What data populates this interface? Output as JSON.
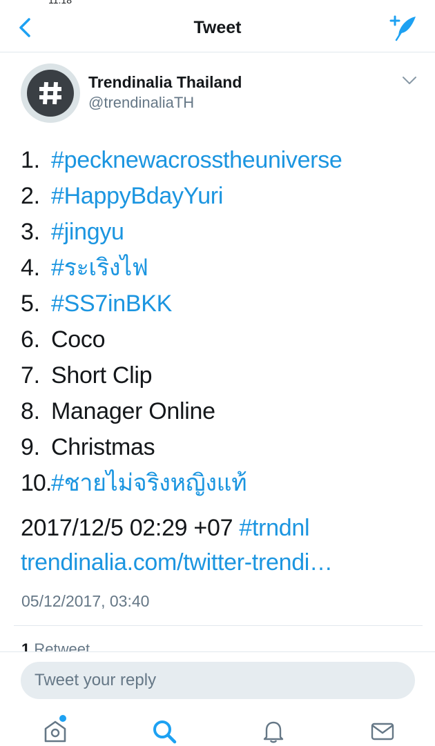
{
  "nav": {
    "title": "Tweet",
    "back_icon": "chevron-left-icon",
    "compose_icon": "compose-tweet-icon",
    "accent": "#1da1f2"
  },
  "status_fragment": "11:18",
  "tweet": {
    "author": {
      "name": "Trendinalia Thailand",
      "handle": "@trendinaliaTH",
      "avatar_icon": "hashtag-avatar-icon"
    },
    "trends": [
      {
        "num": "1.",
        "label": "#pecknewacrosstheuniverse",
        "is_link": true
      },
      {
        "num": "2.",
        "label": "#HappyBdayYuri",
        "is_link": true
      },
      {
        "num": "3.",
        "label": "#jingyu",
        "is_link": true
      },
      {
        "num": "4.",
        "label": "#ระเริงไฟ",
        "is_link": true
      },
      {
        "num": "5.",
        "label": "#SS7inBKK",
        "is_link": true
      },
      {
        "num": "6.",
        "label": "Coco",
        "is_link": false
      },
      {
        "num": "7.",
        "label": "Short Clip",
        "is_link": false
      },
      {
        "num": "8.",
        "label": "Manager Online",
        "is_link": false
      },
      {
        "num": "9.",
        "label": "Christmas",
        "is_link": false
      },
      {
        "num": "10.",
        "label": "#ชายไม่จริงหญิงแท้",
        "is_link": true
      }
    ],
    "datetime_text": "2017/12/5 02:29 +07",
    "hashtag": "#trndnl",
    "url_text": "trendinalia.com/twitter-trendi…",
    "timestamp": "05/12/2017, 03:40",
    "retweet_count": "1",
    "retweet_label": "Retweet"
  },
  "reply": {
    "placeholder": "Tweet your reply"
  },
  "tabbar": {
    "items": [
      "home-icon",
      "search-icon",
      "notifications-icon",
      "messages-icon"
    ],
    "home_has_badge": true
  },
  "colors": {
    "link": "#1b95e0",
    "text": "#14171a",
    "secondary": "#657786",
    "border": "#e1e8ed"
  }
}
